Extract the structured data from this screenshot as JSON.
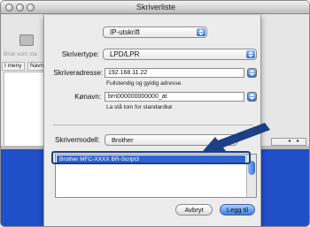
{
  "window": {
    "title": "Skriverliste"
  },
  "background": {
    "toolbar_label": "Bruk som sta",
    "tabs": [
      "I meny",
      "Navn"
    ]
  },
  "sheet": {
    "connection_popup": "IP-utskrift",
    "printer_type_label": "Skrivertype:",
    "printer_type_value": "LPD/LPR",
    "address_label": "Skriveradresse:",
    "address_value": "192.168.11.22",
    "address_hint": "Fullstendig og gyldig adresse.",
    "queue_label": "Kønavn:",
    "queue_value": "brn000000000000_at",
    "queue_hint": "La stå tom for standardkø",
    "model_label": "Skrivermodell:",
    "model_value": "Brother",
    "model_list": [
      "Brother MFC-XXXX BR-Script3"
    ],
    "cancel_label": "Avbryt",
    "add_label": "Legg til"
  },
  "colors": {
    "selection": "#2d63d5",
    "callout_arrow": "#1d3f86",
    "desktop_blue": "#1f4fc9"
  }
}
